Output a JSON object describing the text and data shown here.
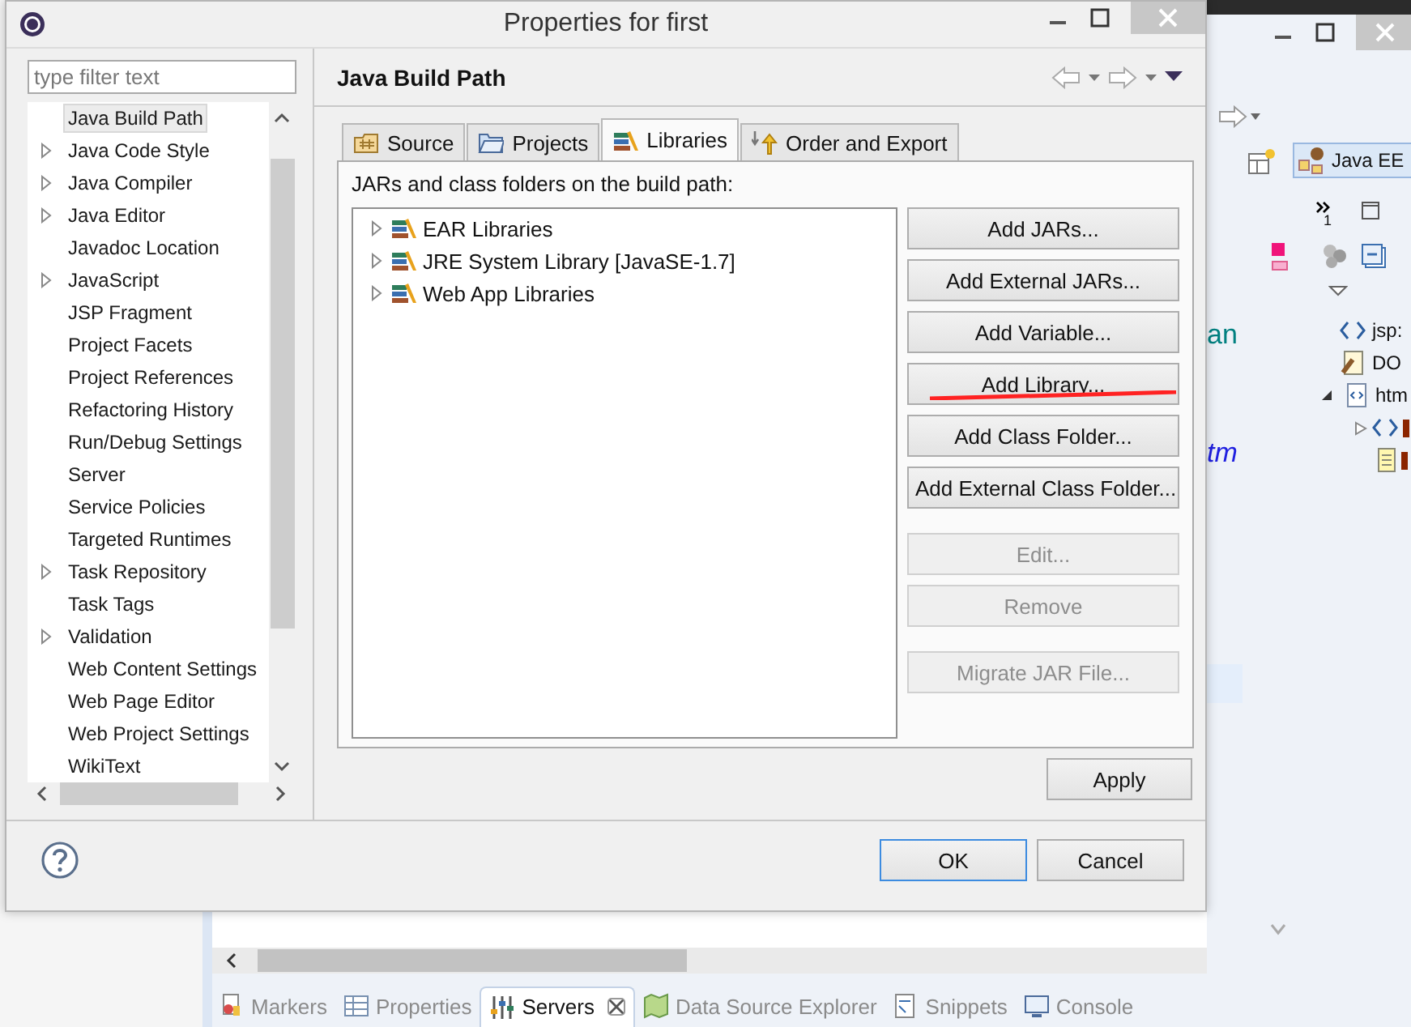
{
  "background_window": {
    "perspective": "Java EE",
    "outline_count": "1",
    "outline_items": [
      "jsp:",
      "DO",
      "htm"
    ],
    "editor_fragments": [
      "an",
      "tm"
    ],
    "view_tabs": [
      {
        "label": "Markers",
        "selected": false,
        "closable": false
      },
      {
        "label": "Properties",
        "selected": false,
        "closable": false
      },
      {
        "label": "Servers",
        "selected": true,
        "closable": true
      },
      {
        "label": "Data Source Explorer",
        "selected": false,
        "closable": false
      },
      {
        "label": "Snippets",
        "selected": false,
        "closable": false
      },
      {
        "label": "Console",
        "selected": false,
        "closable": false
      }
    ]
  },
  "dialog": {
    "title": "Properties for first",
    "filter": {
      "placeholder": "type filter text"
    },
    "categories": [
      {
        "label": "Java Build Path",
        "expandable": false,
        "selected": true
      },
      {
        "label": "Java Code Style",
        "expandable": true,
        "selected": false
      },
      {
        "label": "Java Compiler",
        "expandable": true,
        "selected": false
      },
      {
        "label": "Java Editor",
        "expandable": true,
        "selected": false
      },
      {
        "label": "Javadoc Location",
        "expandable": false,
        "selected": false
      },
      {
        "label": "JavaScript",
        "expandable": true,
        "selected": false
      },
      {
        "label": "JSP Fragment",
        "expandable": false,
        "selected": false
      },
      {
        "label": "Project Facets",
        "expandable": false,
        "selected": false
      },
      {
        "label": "Project References",
        "expandable": false,
        "selected": false
      },
      {
        "label": "Refactoring History",
        "expandable": false,
        "selected": false
      },
      {
        "label": "Run/Debug Settings",
        "expandable": false,
        "selected": false
      },
      {
        "label": "Server",
        "expandable": false,
        "selected": false
      },
      {
        "label": "Service Policies",
        "expandable": false,
        "selected": false
      },
      {
        "label": "Targeted Runtimes",
        "expandable": false,
        "selected": false
      },
      {
        "label": "Task Repository",
        "expandable": true,
        "selected": false
      },
      {
        "label": "Task Tags",
        "expandable": false,
        "selected": false
      },
      {
        "label": "Validation",
        "expandable": true,
        "selected": false
      },
      {
        "label": "Web Content Settings",
        "expandable": false,
        "selected": false
      },
      {
        "label": "Web Page Editor",
        "expandable": false,
        "selected": false
      },
      {
        "label": "Web Project Settings",
        "expandable": false,
        "selected": false
      },
      {
        "label": "WikiText",
        "expandable": false,
        "selected": false
      }
    ],
    "page_title": "Java Build Path",
    "tabs": [
      {
        "label": "Source",
        "kind": "source",
        "selected": false
      },
      {
        "label": "Projects",
        "kind": "projects",
        "selected": false
      },
      {
        "label": "Libraries",
        "kind": "libraries",
        "selected": true
      },
      {
        "label": "Order and Export",
        "kind": "order",
        "selected": false
      }
    ],
    "list_label": "JARs and class folders on the build path:",
    "libraries": [
      {
        "label": "EAR Libraries",
        "expanded": false
      },
      {
        "label": "JRE System Library [JavaSE-1.7]",
        "expanded": false
      },
      {
        "label": "Web App Libraries",
        "expanded": false
      }
    ],
    "buttons": [
      {
        "label": "Add JARs...",
        "disabled": false,
        "annotated": false
      },
      {
        "label": "Add External JARs...",
        "disabled": false,
        "annotated": false
      },
      {
        "label": "Add Variable...",
        "disabled": false,
        "annotated": false
      },
      {
        "label": "Add Library...",
        "disabled": false,
        "annotated": true
      },
      {
        "label": "Add Class Folder...",
        "disabled": false,
        "annotated": false
      },
      {
        "label": "Add External Class Folder...",
        "disabled": false,
        "annotated": false
      },
      {
        "label": "Edit...",
        "disabled": true,
        "annotated": false
      },
      {
        "label": "Remove",
        "disabled": true,
        "annotated": false
      },
      {
        "label": "Migrate JAR File...",
        "disabled": true,
        "annotated": false
      }
    ],
    "apply": "Apply",
    "footer_buttons": [
      {
        "label": "OK",
        "default": true
      },
      {
        "label": "Cancel",
        "default": false
      }
    ]
  }
}
